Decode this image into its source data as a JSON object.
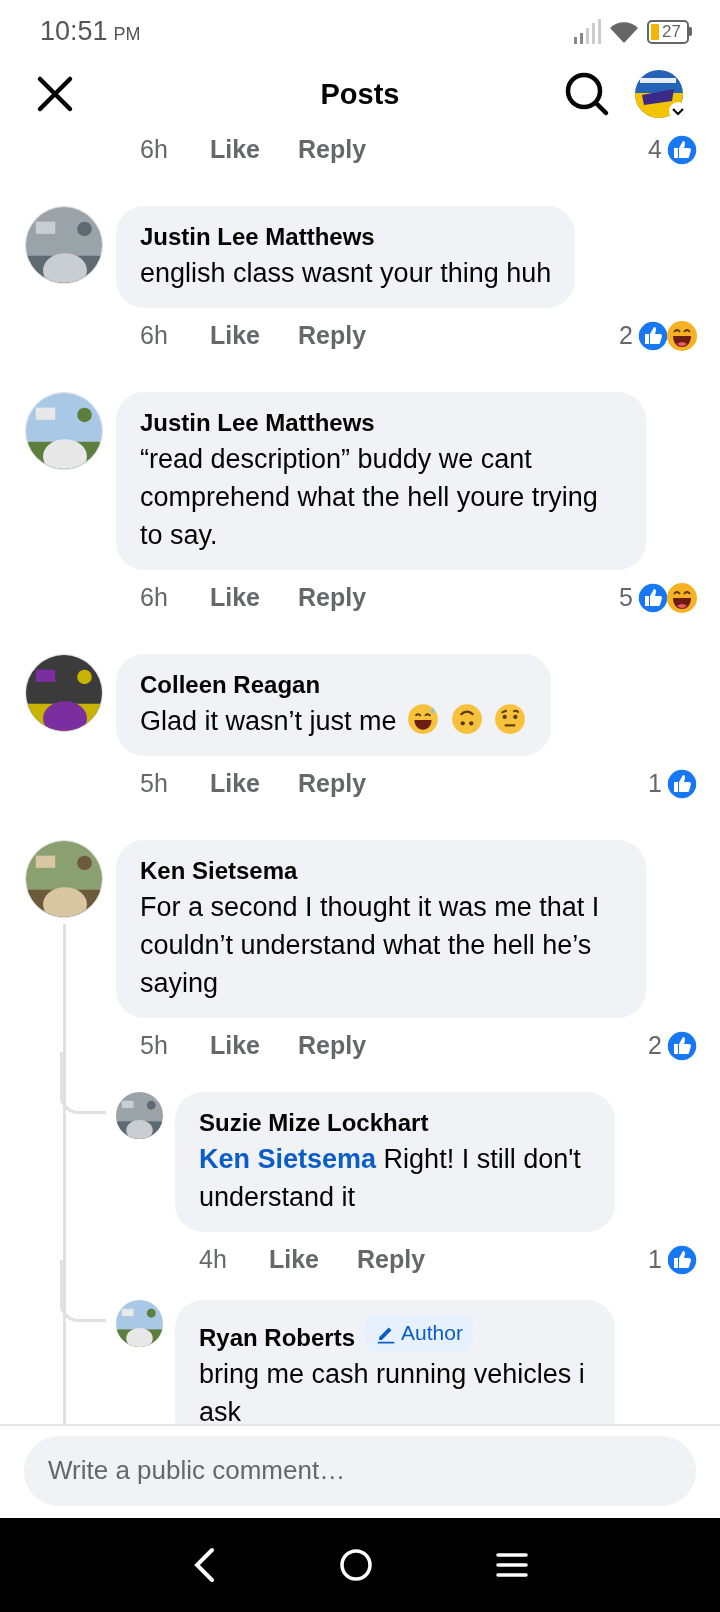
{
  "status_bar": {
    "time": "10:51",
    "ampm": "PM",
    "battery": "27"
  },
  "header": {
    "title": "Posts"
  },
  "top_action_row": {
    "time": "6h",
    "like": "Like",
    "reply": "Reply",
    "count": "4",
    "reactions": [
      {
        "kind": "like"
      }
    ]
  },
  "comments": [
    {
      "name": "Justin Lee Matthews",
      "text": "english class wasnt your thing huh",
      "time": "6h",
      "like": "Like",
      "reply": "Reply",
      "count": "2",
      "reactions": [
        {
          "kind": "like"
        },
        {
          "kind": "haha"
        }
      ]
    },
    {
      "name": "Justin Lee Matthews",
      "text": "“read description” buddy we cant comprehend what the hell youre trying to say.",
      "time": "6h",
      "like": "Like",
      "reply": "Reply",
      "count": "5",
      "reactions": [
        {
          "kind": "like"
        },
        {
          "kind": "haha"
        }
      ]
    },
    {
      "name": "Colleen Reagan",
      "text": "Glad it wasn’t just me",
      "emoji_icons": [
        {
          "kind": "sweat-smile"
        },
        {
          "kind": "upside-down"
        },
        {
          "kind": "raised-eyebrow"
        }
      ],
      "time": "5h",
      "like": "Like",
      "reply": "Reply",
      "count": "1",
      "reactions": [
        {
          "kind": "like"
        }
      ]
    },
    {
      "name": "Ken Sietsema",
      "text": "For a second I thought it was me that I couldn’t understand what the hell he’s saying",
      "time": "5h",
      "like": "Like",
      "reply": "Reply",
      "count": "2",
      "reactions": [
        {
          "kind": "like"
        }
      ],
      "replies": [
        {
          "name": "Suzie Mize Lockhart",
          "mention": "Ken Sietsema",
          "text": "Right! I still don't understand it",
          "time": "4h",
          "like": "Like",
          "reply": "Reply",
          "count": "1",
          "reactions": [
            {
              "kind": "like"
            }
          ]
        },
        {
          "name": "Ryan Roberts",
          "badge": "Author",
          "text": "bring me cash running vehicles i ask"
        }
      ]
    }
  ],
  "composer": {
    "placeholder": "Write a public comment…"
  }
}
